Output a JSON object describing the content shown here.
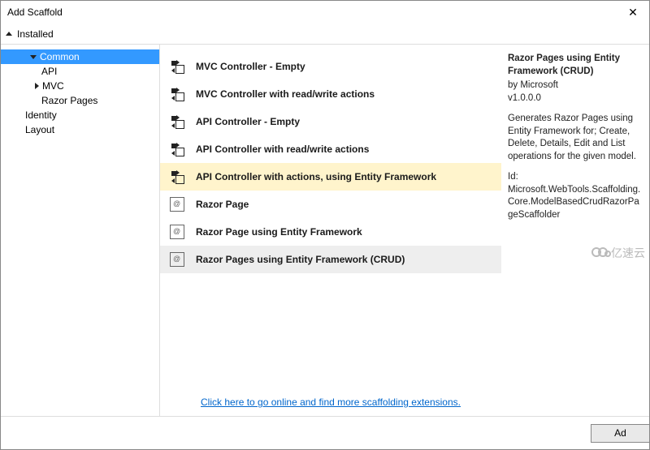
{
  "title": "Add Scaffold",
  "crumb": "Installed",
  "tree": {
    "common": "Common",
    "api": "API",
    "mvc": "MVC",
    "razor": "Razor Pages",
    "identity": "Identity",
    "layout": "Layout"
  },
  "items": [
    {
      "label": "MVC Controller - Empty",
      "icon": "controller"
    },
    {
      "label": "MVC Controller with read/write actions",
      "icon": "controller"
    },
    {
      "label": "API Controller - Empty",
      "icon": "controller"
    },
    {
      "label": "API Controller with read/write actions",
      "icon": "controller"
    },
    {
      "label": "API Controller with actions, using Entity Framework",
      "icon": "controller",
      "highlight": true
    },
    {
      "label": "Razor Page",
      "icon": "page"
    },
    {
      "label": "Razor Page using Entity Framework",
      "icon": "page"
    },
    {
      "label": "Razor Pages using Entity Framework (CRUD)",
      "icon": "page",
      "selected": true
    }
  ],
  "link": "Click here to go online and find more scaffolding extensions.",
  "details": {
    "title": "Razor Pages using Entity Framework (CRUD)",
    "by": "by Microsoft",
    "version": "v1.0.0.0",
    "desc": "Generates Razor Pages using Entity Framework for; Create, Delete, Details, Edit and List operations for the given model.",
    "id": "Id: Microsoft.WebTools.Scaffolding.Core.ModelBasedCrudRazorPageScaffolder"
  },
  "buttons": {
    "add": "Ad"
  },
  "watermark": "亿速云"
}
